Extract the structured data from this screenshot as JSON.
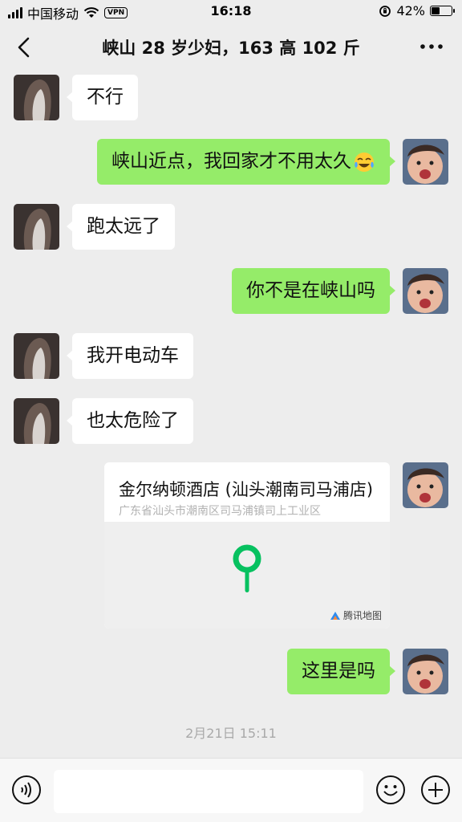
{
  "status_bar": {
    "carrier": "中国移动",
    "vpn": "VPN",
    "time": "16:18",
    "battery": "42%",
    "battery_level": 0.42
  },
  "header": {
    "title": "峡山 28 岁少妇，163 高 102 斤"
  },
  "messages": [
    {
      "side": "left",
      "text": "不行"
    },
    {
      "side": "right",
      "text": "峡山近点，我回家才不用太久",
      "emoji": "tears-of-joy"
    },
    {
      "side": "left",
      "text": "跑太远了"
    },
    {
      "side": "right",
      "text": "你不是在峡山吗"
    },
    {
      "side": "left",
      "text": "我开电动车"
    },
    {
      "side": "left",
      "text": "也太危险了"
    },
    {
      "side": "right",
      "text": "这里是吗"
    }
  ],
  "location_card": {
    "name": "金尔纳顿酒店 (汕头潮南司马浦店)",
    "address": "广东省汕头市潮南区司马浦镇司上工业区",
    "map_brand": "腾讯地图"
  },
  "timestamp": "2月21日 15:11",
  "colors": {
    "background": "#ededed",
    "bubble_sent": "#95ec69",
    "bubble_received": "#ffffff",
    "pin": "#07c160"
  }
}
